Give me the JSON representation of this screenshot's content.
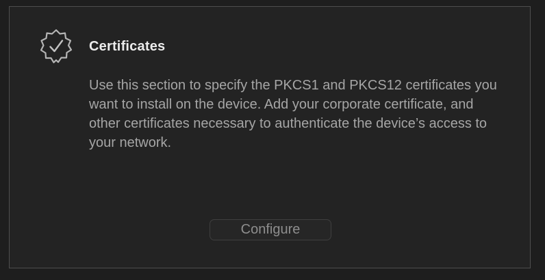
{
  "section": {
    "icon": "certificate-seal-checkmark-icon",
    "title": "Certificates",
    "description": "Use this section to specify the PKCS1 and PKCS12 certificates you want to install on the device. Add your corporate certificate, and other certificates necessary to authenticate the device’s access to your network.",
    "configure_label": "Configure"
  },
  "colors": {
    "panel_background": "#232323",
    "panel_border": "#4e4e4e",
    "title_text": "#ececec",
    "body_text": "#a6a6a6",
    "button_text": "#8e8e8e"
  }
}
